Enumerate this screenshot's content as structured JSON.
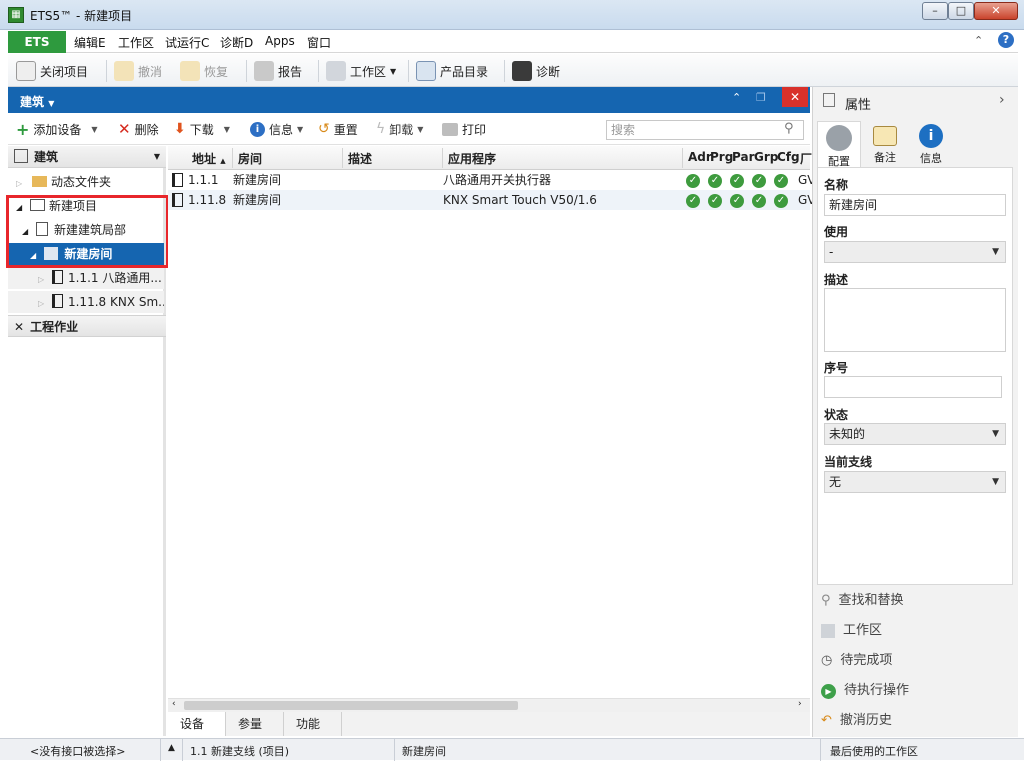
{
  "window": {
    "title": "ETS5™ - 新建项目",
    "app_icon": "ets-app-icon",
    "minimize": "–",
    "maximize": "□",
    "close": "✕"
  },
  "menu": {
    "ets": "ETS",
    "items": [
      "编辑E",
      "工作区",
      "试运行C",
      "诊断D",
      "Apps",
      "窗口"
    ]
  },
  "toolbar": {
    "close_project": "关闭项目",
    "undo": "撤消",
    "redo": "恢复",
    "report": "报告",
    "workspace": "工作区",
    "catalog": "产品目录",
    "diagnostics": "诊断"
  },
  "panel": {
    "title": "建筑",
    "add_device": "添加设备",
    "delete": "删除",
    "download": "下载",
    "info": "信息",
    "reset": "重置",
    "unload": "卸载",
    "print": "打印",
    "search_placeholder": "搜索"
  },
  "tree": {
    "section_buildings": "建筑",
    "dynamic_folder": "动态文件夹",
    "project": "新建项目",
    "building_part": "新建建筑局部",
    "room": "新建房间",
    "device1": "1.1.1 八路通用...",
    "device2": "1.11.8 KNX Sm...",
    "section_jobs": "工程作业"
  },
  "grid": {
    "headers": {
      "address": "地址",
      "room": "房间",
      "description": "描述",
      "application": "应用程序",
      "adr": "Adr",
      "prg": "Prg",
      "par": "Par",
      "grp": "Grp",
      "cfg": "Cfg",
      "manufacturer": "厂"
    },
    "rows": [
      {
        "address": "1.1.1",
        "room": "新建房间",
        "description": "",
        "application": "八路通用开关执行器",
        "manufacturer": "GV"
      },
      {
        "address": "1.11.8",
        "room": "新建房间",
        "description": "",
        "application": "KNX Smart Touch V50/1.6",
        "manufacturer": "GV"
      }
    ],
    "check_color": "#3e9b3e"
  },
  "bottom_tabs": [
    "设备",
    "参量",
    "功能"
  ],
  "properties": {
    "title": "属性",
    "tabs": [
      "配置",
      "备注",
      "信息"
    ],
    "name_label": "名称",
    "name_value": "新建房间",
    "usage_label": "使用",
    "usage_value": "-",
    "description_label": "描述",
    "serial_label": "序号",
    "status_label": "状态",
    "status_value": "未知的",
    "branch_label": "当前支线",
    "branch_value": "无"
  },
  "side_links": [
    "查找和替换",
    "工作区",
    "待完成项",
    "待执行操作",
    "撤消历史"
  ],
  "statusbar": {
    "interface": "<没有接口被选择>",
    "line": "1.1 新建支线 (项目)",
    "location": "新建房间",
    "last_workspace": "最后使用的工作区"
  },
  "colors": {
    "accent_blue": "#1565b0",
    "ets_green": "#2e9a3e",
    "highlight_red": "#e8262b"
  }
}
